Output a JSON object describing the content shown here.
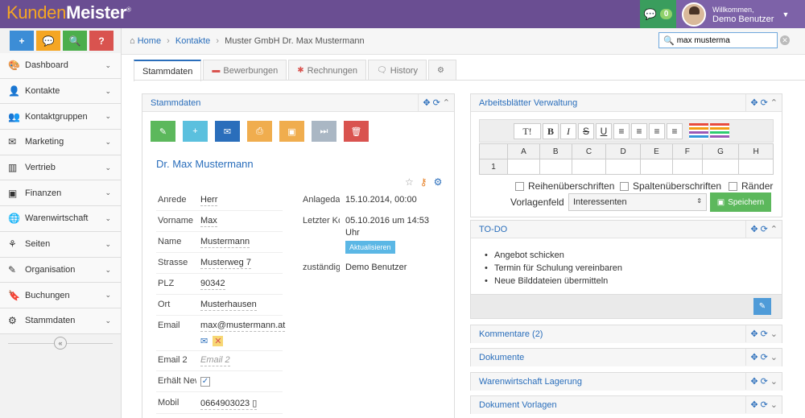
{
  "app": {
    "logo_part1": "Kunden",
    "logo_part2": "Meister",
    "logo_reg": "®"
  },
  "header": {
    "chat_count": "0",
    "welcome": "Willkommen,",
    "user_name": "Demo Benutzer"
  },
  "quick_buttons": [
    {
      "label": "+",
      "color": "#3c8dd6"
    },
    {
      "label": "💬",
      "color": "#f5a623"
    },
    {
      "label": "🔍",
      "color": "#4cae4c"
    },
    {
      "label": "?",
      "color": "#d9534f"
    }
  ],
  "sidebar": {
    "items": [
      {
        "label": "Dashboard",
        "icon": "🎨",
        "icon_name": "palette-icon"
      },
      {
        "label": "Kontakte",
        "icon": "👤",
        "icon_name": "user-icon"
      },
      {
        "label": "Kontaktgruppen",
        "icon": "👥",
        "icon_name": "users-icon"
      },
      {
        "label": "Marketing",
        "icon": "✉",
        "icon_name": "envelope-icon"
      },
      {
        "label": "Vertrieb",
        "icon": "▥",
        "icon_name": "bar-chart-icon"
      },
      {
        "label": "Finanzen",
        "icon": "▣",
        "icon_name": "money-icon"
      },
      {
        "label": "Warenwirtschaft",
        "icon": "🌐",
        "icon_name": "globe-icon"
      },
      {
        "label": "Seiten",
        "icon": "⚘",
        "icon_name": "sitemap-icon"
      },
      {
        "label": "Organisation",
        "icon": "✎",
        "icon_name": "edit-icon"
      },
      {
        "label": "Buchungen",
        "icon": "🔖",
        "icon_name": "bookmark-icon"
      },
      {
        "label": "Stammdaten",
        "icon": "⚙",
        "icon_name": "cogs-icon"
      }
    ]
  },
  "breadcrumb": {
    "home": "Home",
    "kontakte": "Kontakte",
    "current": "Muster GmbH Dr. Max Mustermann"
  },
  "search": {
    "value": "max musterma"
  },
  "tabs": [
    {
      "label": "Stammdaten",
      "icon": ""
    },
    {
      "label": "Bewerbungen",
      "icon": "▬"
    },
    {
      "label": "Rechnungen",
      "icon": "✱"
    },
    {
      "label": "History",
      "icon": "🗨"
    },
    {
      "label": "",
      "icon": "⚙"
    }
  ],
  "stammdaten": {
    "title": "Stammdaten",
    "name": "Dr. Max Mustermann",
    "fields": [
      {
        "label": "Anrede",
        "value": "Herr"
      },
      {
        "label": "Vorname",
        "value": "Max"
      },
      {
        "label": "Name",
        "value": "Mustermann"
      },
      {
        "label": "Strasse",
        "value": "Musterweg 7"
      },
      {
        "label": "PLZ",
        "value": "90342"
      },
      {
        "label": "Ort",
        "value": "Musterhausen"
      },
      {
        "label": "Email",
        "value": "max@mustermann.at"
      },
      {
        "label": "Email 2",
        "value": "Email 2"
      },
      {
        "label": "Erhält Newsletter",
        "value": ""
      },
      {
        "label": "Mobil",
        "value": "0664903023 ▯"
      }
    ],
    "right": [
      {
        "label": "Anlagedatum",
        "value": "15.10.2014, 00:00"
      },
      {
        "label": "Letzter Kontakt",
        "value": "05.10.2016 um 14:53",
        "value2": "Uhr"
      },
      {
        "label": "zuständig",
        "value": "Demo Benutzer"
      }
    ],
    "update_label": "Aktualisieren"
  },
  "action_buttons": [
    {
      "name": "edit-button",
      "icon": "✎",
      "color": "#5cb85c"
    },
    {
      "name": "add-button",
      "icon": "+",
      "color": "#5bc0de"
    },
    {
      "name": "mail-button",
      "icon": "✉",
      "color": "#2a6ebb"
    },
    {
      "name": "print-button",
      "icon": "⎙",
      "color": "#f0ad4e"
    },
    {
      "name": "save-button",
      "icon": "▣",
      "color": "#f0ad4e"
    },
    {
      "name": "skip-button",
      "icon": "⏭",
      "color": "#aab7c4"
    },
    {
      "name": "delete-button",
      "icon": "🗑",
      "color": "#d9534f"
    }
  ],
  "arbeitsblaetter": {
    "title": "Arbeitsblätter Verwaltung",
    "columns": [
      "A",
      "B",
      "C",
      "D",
      "E",
      "F",
      "G",
      "H"
    ],
    "row_number": "1",
    "opt1": "Reihenüberschriften",
    "opt2": "Spaltenüberschriften",
    "opt3": "Ränder",
    "vorlage_label": "Vorlagenfeld",
    "vorlage_value": "Interessenten",
    "save_label": "Speichern"
  },
  "todo": {
    "title": "TO-DO",
    "items": [
      "Angebot schicken",
      "Termin für Schulung vereinbaren",
      "Neue Bilddateien übermitteln"
    ]
  },
  "collapsed": [
    {
      "title": "Kommentare (2)"
    },
    {
      "title": "Dokumente"
    },
    {
      "title": "Warenwirtschaft Lagerung"
    },
    {
      "title": "Dokument Vorlagen"
    }
  ]
}
